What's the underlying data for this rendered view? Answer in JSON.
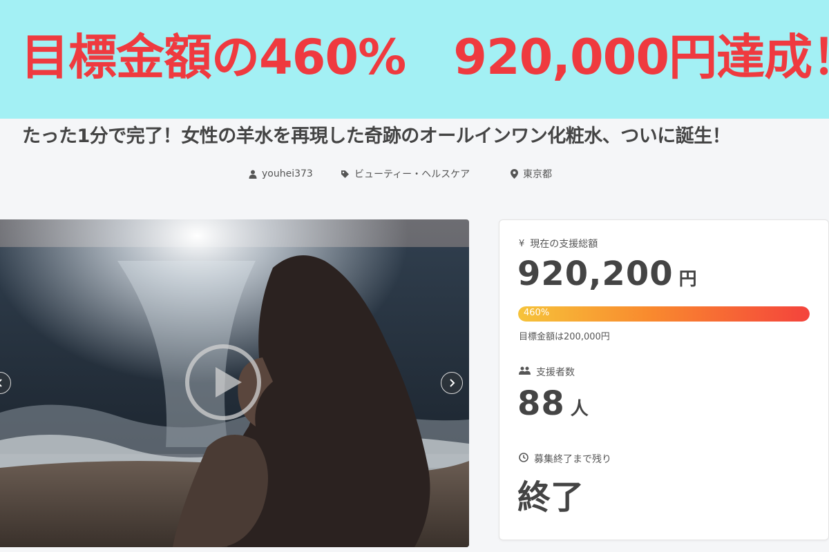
{
  "banner": {
    "headline": "目標金額の460%　920,000円達成！",
    "bg_color": "#a3f0f4",
    "text_color": "#ef3a3f"
  },
  "project": {
    "title": "たった1分で完了！女性の羊水を再現した奇跡のオールインワン化粧水、ついに誕生！",
    "owner": "youhei373",
    "category": "ビューティー・ヘルスケア",
    "location": "東京都"
  },
  "media": {
    "image_description_icon": "image-slide",
    "has_video": true
  },
  "stats": {
    "amount_label": "現在の支援総額",
    "amount_value": "920,200",
    "amount_unit": "円",
    "progress_percent_label": "460%",
    "progress_fraction": 1.0,
    "goal_text": "目標金額は200,000円",
    "supporters_label": "支援者数",
    "supporters_value": "88",
    "supporters_unit": "人",
    "remaining_label": "募集終了まで残り",
    "remaining_value": "終了"
  },
  "colors": {
    "progress_start": "#f6c33a",
    "progress_end": "#f4433c",
    "page_bg": "#f5f6f8"
  }
}
